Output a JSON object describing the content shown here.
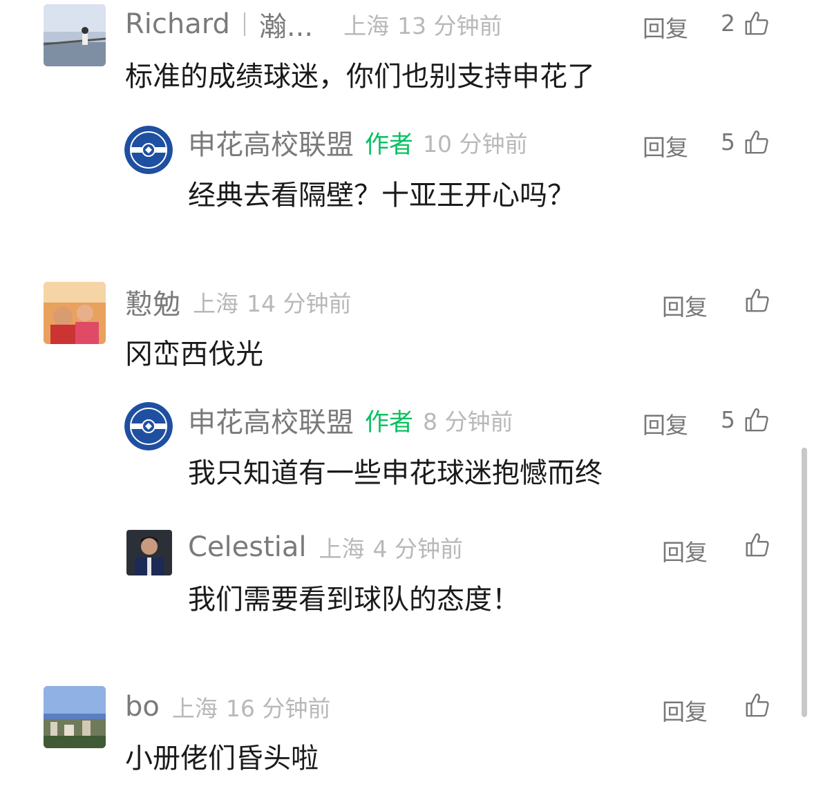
{
  "comments": [
    {
      "name": "Richard",
      "name2": "瀚...",
      "location": "上海",
      "time": "13 分钟前",
      "reply": "回复",
      "likes": "2",
      "text": "标准的成绩球迷，你们也别支持申花了"
    },
    {
      "name": "申花高校联盟",
      "author": "作者",
      "time": "10 分钟前",
      "reply": "回复",
      "likes": "5",
      "text": "经典去看隔壁？十亚王开心吗？"
    },
    {
      "name": "懃勉",
      "location": "上海",
      "time": "14 分钟前",
      "reply": "回复",
      "likes": "",
      "text": "冈峦西伐光"
    },
    {
      "name": "申花高校联盟",
      "author": "作者",
      "time": "8 分钟前",
      "reply": "回复",
      "likes": "5",
      "text": "我只知道有一些申花球迷抱憾而终"
    },
    {
      "name": "Celestial",
      "location": "上海",
      "time": "4 分钟前",
      "reply": "回复",
      "likes": "",
      "text": "我们需要看到球队的态度！"
    },
    {
      "name": "bo",
      "location": "上海",
      "time": "16 分钟前",
      "reply": "回复",
      "likes": "",
      "text": "小册佬们昏头啦"
    }
  ],
  "colors": {
    "author": "#07c160",
    "meta": "#b8b8b8",
    "name": "#7a7a7a",
    "logo": "#1f4fa0"
  }
}
